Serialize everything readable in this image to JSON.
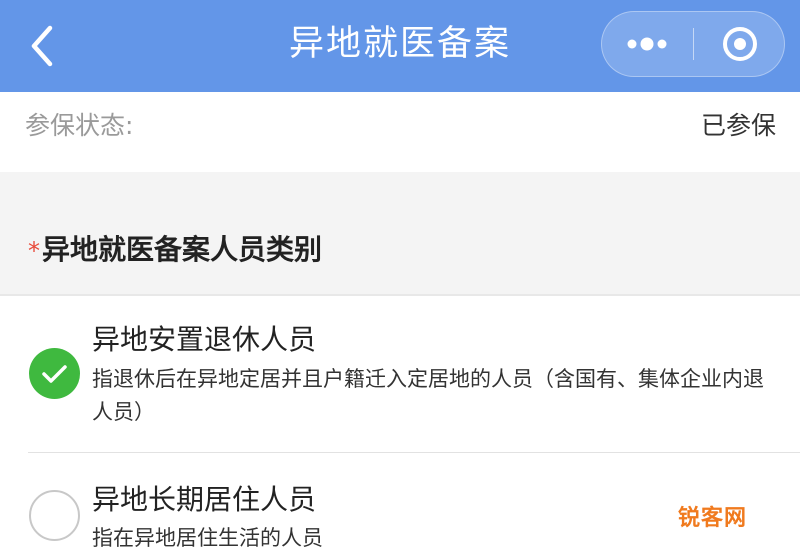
{
  "header": {
    "title": "异地就医备案",
    "back_icon": "chevron-left-icon",
    "more_icon": "more-dots-icon",
    "close_icon": "target-circle-icon",
    "background": "#6396e8"
  },
  "status": {
    "label": "参保状态:",
    "value": "已参保"
  },
  "section": {
    "required_mark": "*",
    "title": "异地就医备案人员类别"
  },
  "options": [
    {
      "title": "异地安置退休人员",
      "description": "指退休后在异地定居并且户籍迁入定居地的人员（含国有、集体企业内退人员）",
      "selected": true
    },
    {
      "title": "异地长期居住人员",
      "description": "指在异地居住生活的人员",
      "selected": false
    }
  ],
  "watermark": "锐客网",
  "colors": {
    "accent": "#6396e8",
    "check": "#3fb93f",
    "required": "#e84a3a",
    "watermark": "#f07a1e"
  }
}
